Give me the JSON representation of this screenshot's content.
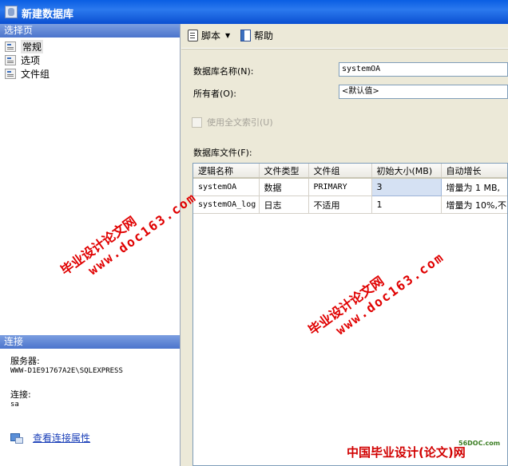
{
  "window": {
    "title": "新建数据库"
  },
  "left_panel": {
    "pages_header": "选择页",
    "pages": [
      {
        "label": "常规",
        "selected": true
      },
      {
        "label": "选项",
        "selected": false
      },
      {
        "label": "文件组",
        "selected": false
      }
    ],
    "connection_header": "连接",
    "server_label": "服务器:",
    "server_value": "WWW-D1E91767A2E\\SQLEXPRESS",
    "connection_label": "连接:",
    "connection_value": "sa",
    "view_properties_link": "查看连接属性"
  },
  "toolbar": {
    "script_label": "脚本",
    "help_label": "帮助"
  },
  "form": {
    "db_name_label": "数据库名称(N):",
    "db_name_value": "systemOA",
    "owner_label": "所有者(O):",
    "owner_value": "<默认值>",
    "fulltext_label": "使用全文索引(U)",
    "fulltext_checked": false,
    "files_label": "数据库文件(F):"
  },
  "files_table": {
    "columns": [
      "逻辑名称",
      "文件类型",
      "文件组",
      "初始大小(MB)",
      "自动增长"
    ],
    "rows": [
      [
        "systemOA",
        "数据",
        "PRIMARY",
        "3",
        "增量为 1 MB,"
      ],
      [
        "systemOA_log",
        "日志",
        "不适用",
        "1",
        "增量为 10%,不"
      ]
    ]
  },
  "watermarks": {
    "title": "毕业设计论文网",
    "url": "www.doc163.com",
    "brand": "中国毕业设计(论文)网",
    "brand_site": "56DOC.com"
  },
  "colors": {
    "titlebar": "#0a5ee3",
    "section_header": "#4b74cc",
    "selected_cell": "#d5e1f3",
    "watermark": "#e00000",
    "link": "#1a3fb8"
  }
}
